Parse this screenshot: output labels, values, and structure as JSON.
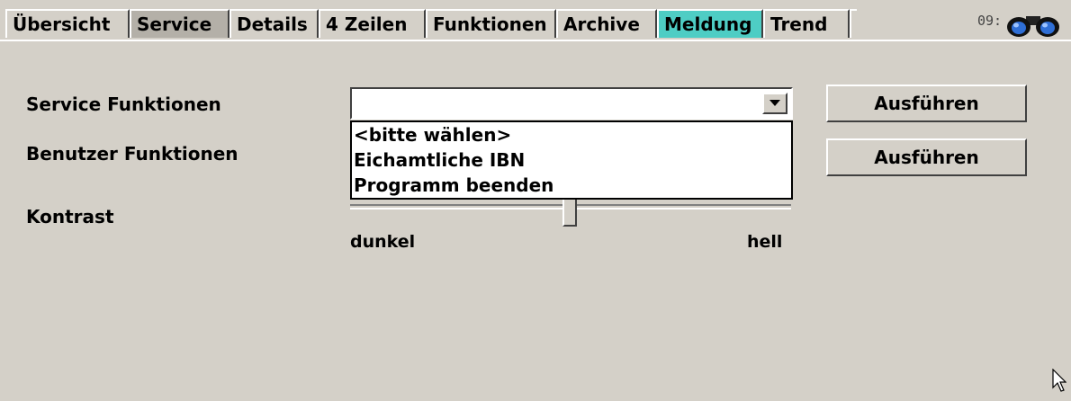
{
  "tabs": [
    {
      "label": "Übersicht",
      "state": "normal"
    },
    {
      "label": "Service",
      "state": "selected"
    },
    {
      "label": "Details",
      "state": "normal"
    },
    {
      "label": "4 Zeilen",
      "state": "normal"
    },
    {
      "label": "Funktionen",
      "state": "normal"
    },
    {
      "label": "Archive",
      "state": "normal"
    },
    {
      "label": "Meldung",
      "state": "alarm"
    },
    {
      "label": "Trend",
      "state": "normal"
    }
  ],
  "header": {
    "clock": "09:"
  },
  "service_functions": {
    "label": "Service Funktionen",
    "selected_value": "",
    "options": [
      "<bitte wählen>",
      "Eichamtliche IBN",
      "Programm beenden"
    ],
    "execute_label": "Ausführen"
  },
  "user_functions": {
    "label": "Benutzer Funktionen",
    "execute_label": "Ausführen"
  },
  "contrast": {
    "label": "Kontrast",
    "min_label": "dunkel",
    "max_label": "hell",
    "value_fraction": 0.5
  },
  "colors": {
    "background": "#d4d0c8",
    "selected_tab": "#b4b0a8",
    "alarm_tab": "#4ecdc4"
  }
}
